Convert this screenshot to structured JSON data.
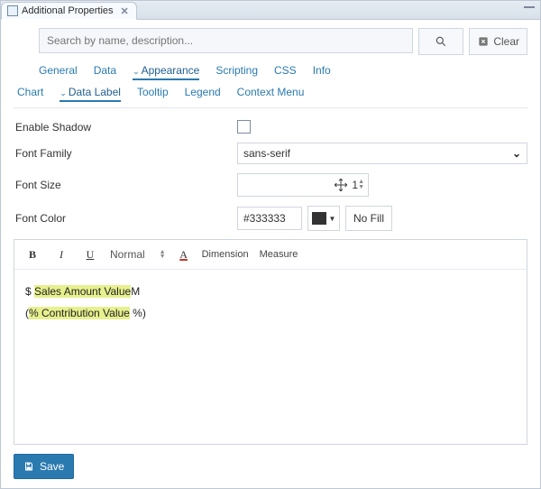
{
  "window": {
    "title": "Additional Properties"
  },
  "search": {
    "placeholder": "Search by name, description...",
    "clear_label": "Clear"
  },
  "main_tabs": {
    "general": "General",
    "data": "Data",
    "appearance": "Appearance",
    "scripting": "Scripting",
    "css": "CSS",
    "info": "Info"
  },
  "sub_tabs": {
    "chart": "Chart",
    "data_label": "Data Label",
    "tooltip": "Tooltip",
    "legend": "Legend",
    "context_menu": "Context Menu"
  },
  "props": {
    "enable_shadow": {
      "label": "Enable Shadow"
    },
    "font_family": {
      "label": "Font Family",
      "value": "sans-serif"
    },
    "font_size": {
      "label": "Font Size",
      "value": "1"
    },
    "font_color": {
      "label": "Font Color",
      "hex": "#333333",
      "nofill": "No Fill"
    }
  },
  "editor": {
    "toolbar": {
      "normal": "Normal",
      "dimension": "Dimension",
      "measure": "Measure"
    },
    "line1": {
      "prefix": "$ ",
      "token": "Sales Amount Value",
      "suffix": "M"
    },
    "line2": {
      "prefix": "(",
      "token": "% Contribution Value",
      "suffix": " %)"
    }
  },
  "footer": {
    "save": "Save"
  }
}
